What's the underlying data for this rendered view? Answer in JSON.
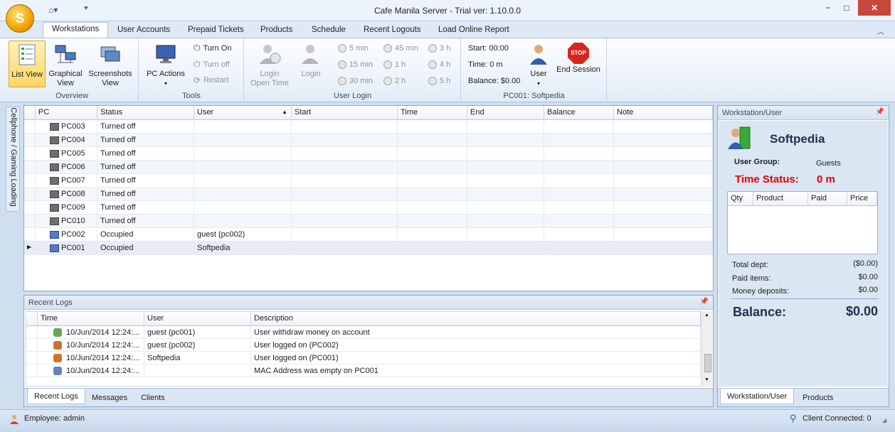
{
  "window": {
    "title": "Cafe Manila Server - Trial ver: 1.10.0.0"
  },
  "tabs": [
    "Workstations",
    "User Accounts",
    "Prepaid Tickets",
    "Products",
    "Schedule",
    "Recent Logouts",
    "Load Online Report"
  ],
  "ribbon": {
    "overview": {
      "label": "Overview",
      "list_view": "List View",
      "graphical_view_1": "Graphical",
      "graphical_view_2": "View",
      "screenshots_view_1": "Screenshots",
      "screenshots_view_2": "View"
    },
    "tools": {
      "label": "Tools",
      "pc_actions": "PC Actions",
      "turn_on": "Turn On",
      "turn_off": "Turn off",
      "restart": "Restart"
    },
    "user_login": {
      "label": "User Login",
      "login_open_time_1": "Login",
      "login_open_time_2": "Open Time",
      "login": "Login",
      "times": [
        "5 min",
        "15 min",
        "30 min",
        "45 min",
        "1 h",
        "2 h",
        "3 h",
        "4 h",
        "5 h"
      ]
    },
    "session": {
      "label": "PC001: Softpedia",
      "start": "Start: 00:00",
      "time": "Time: 0 m",
      "balance": "Balance: $0.00",
      "user": "User",
      "end_session": "End Session",
      "stop_text": "STOP"
    }
  },
  "side_tab": "Cellphone / Gaming Loading",
  "workstations": {
    "columns": [
      "PC",
      "Status",
      "User",
      "Start",
      "Time",
      "End",
      "Balance",
      "Note"
    ],
    "rows": [
      {
        "pc": "PC003",
        "status": "Turned off",
        "user": ""
      },
      {
        "pc": "PC004",
        "status": "Turned off",
        "user": ""
      },
      {
        "pc": "PC005",
        "status": "Turned off",
        "user": ""
      },
      {
        "pc": "PC006",
        "status": "Turned off",
        "user": ""
      },
      {
        "pc": "PC007",
        "status": "Turned off",
        "user": ""
      },
      {
        "pc": "PC008",
        "status": "Turned off",
        "user": ""
      },
      {
        "pc": "PC009",
        "status": "Turned off",
        "user": ""
      },
      {
        "pc": "PC010",
        "status": "Turned off",
        "user": ""
      },
      {
        "pc": "PC002",
        "status": "Occupied",
        "user": "guest (pc002)"
      },
      {
        "pc": "PC001",
        "status": "Occupied",
        "user": "Softpedia"
      }
    ]
  },
  "recent_logs": {
    "title": "Recent Logs",
    "columns": [
      "Time",
      "User",
      "Description"
    ],
    "rows": [
      {
        "time": "10/Jun/2014 12:24:...",
        "user": "guest (pc001)",
        "desc": "User withdraw money on account"
      },
      {
        "time": "10/Jun/2014 12:24:...",
        "user": "guest (pc002)",
        "desc": "User logged on (PC002)"
      },
      {
        "time": "10/Jun/2014 12:24:...",
        "user": "Softpedia",
        "desc": "User logged on (PC001)"
      },
      {
        "time": "10/Jun/2014 12:24:...",
        "user": "",
        "desc": "MAC Address was empty on PC001"
      }
    ],
    "tabs": [
      "Recent Logs",
      "Messages",
      "Clients"
    ]
  },
  "user_panel": {
    "title": "Workstation/User",
    "name": "Softpedia",
    "group_label": "User Group:",
    "group_value": "Guests",
    "time_status_label": "Time Status:",
    "time_status_value": "0 m",
    "columns": [
      "Qty",
      "Product",
      "Paid",
      "Price"
    ],
    "total_dept_label": "Total dept:",
    "total_dept": "($0.00)",
    "paid_items_label": "Paid items:",
    "paid_items": "$0.00",
    "money_deposits_label": "Money deposits:",
    "money_deposits": "$0.00",
    "balance_label": "Balance:",
    "balance": "$0.00",
    "tabs": [
      "Workstation/User",
      "Products"
    ]
  },
  "status": {
    "employee": "Employee: admin",
    "client_connected": "Client Connected: 0"
  },
  "colors": {
    "accent": "#2b5797",
    "time_status": "#e00000",
    "selection": "#ffd664"
  }
}
